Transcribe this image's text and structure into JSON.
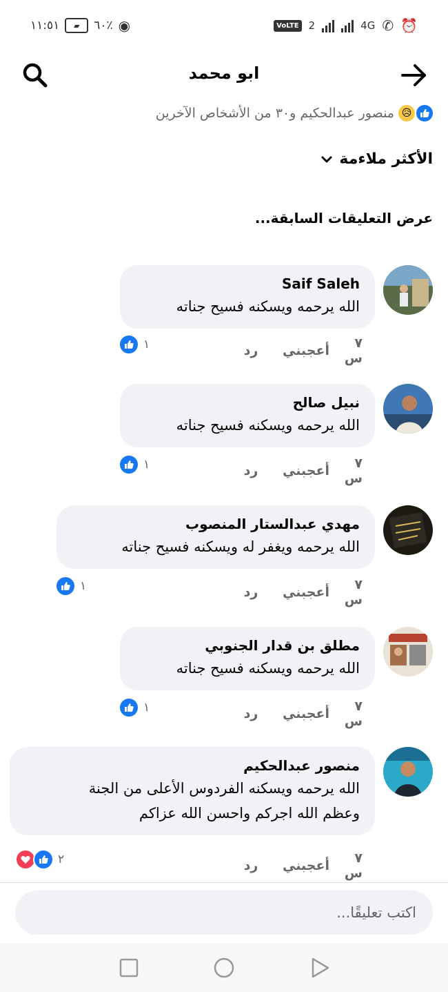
{
  "status_bar": {
    "time": "١١:٥١",
    "battery": "٦٠٪",
    "network": "4G",
    "sim": "2",
    "volte": "VoLTE"
  },
  "header": {
    "title": "ابو محمد",
    "back_icon": "arrow-right-icon",
    "search_icon": "search-icon"
  },
  "reactions_summary": {
    "text": "منصور عبدالحكيم و٣٠ من الأشخاص الآخرين"
  },
  "sort": {
    "label": "الأكثر ملاءمة"
  },
  "view_previous": "عرض التعليقات السابقة...",
  "comments": [
    {
      "author": "Saif Saleh",
      "text": "الله يرحمه ويسكنه فسيح جناته",
      "time": "٧ س",
      "like": "أعجبني",
      "reply": "رد",
      "reactions": "١"
    },
    {
      "author": "نبيل صالح",
      "text": "الله يرحمه ويسكنه فسيح جناته",
      "time": "٧ س",
      "like": "أعجبني",
      "reply": "رد",
      "reactions": "١"
    },
    {
      "author": "مهدي عبدالستار المنصوب",
      "text": "الله يرحمه ويغفر له ويسكنه فسيح جناته",
      "time": "٧ س",
      "like": "أعجبني",
      "reply": "رد",
      "reactions": "١"
    },
    {
      "author": "مطلق بن قدار الجنوبي",
      "text": "الله يرحمه ويسكنه فسيح جناته",
      "time": "٧ س",
      "like": "أعجبني",
      "reply": "رد",
      "reactions": "١"
    },
    {
      "author": "منصور عبدالحكيم",
      "text": "الله يرحمه ويسكنه الفردوس الأعلى من الجنة\nوعظم الله اجركم واحسن الله عزاكم",
      "time": "٧ س",
      "like": "أعجبني",
      "reply": "رد",
      "reactions": "٢"
    }
  ],
  "comment_input": {
    "placeholder": "اكتب تعليقًا..."
  },
  "colors": {
    "accent": "#1877f2",
    "bubble": "#f0f2f5",
    "muted": "#65676b"
  }
}
